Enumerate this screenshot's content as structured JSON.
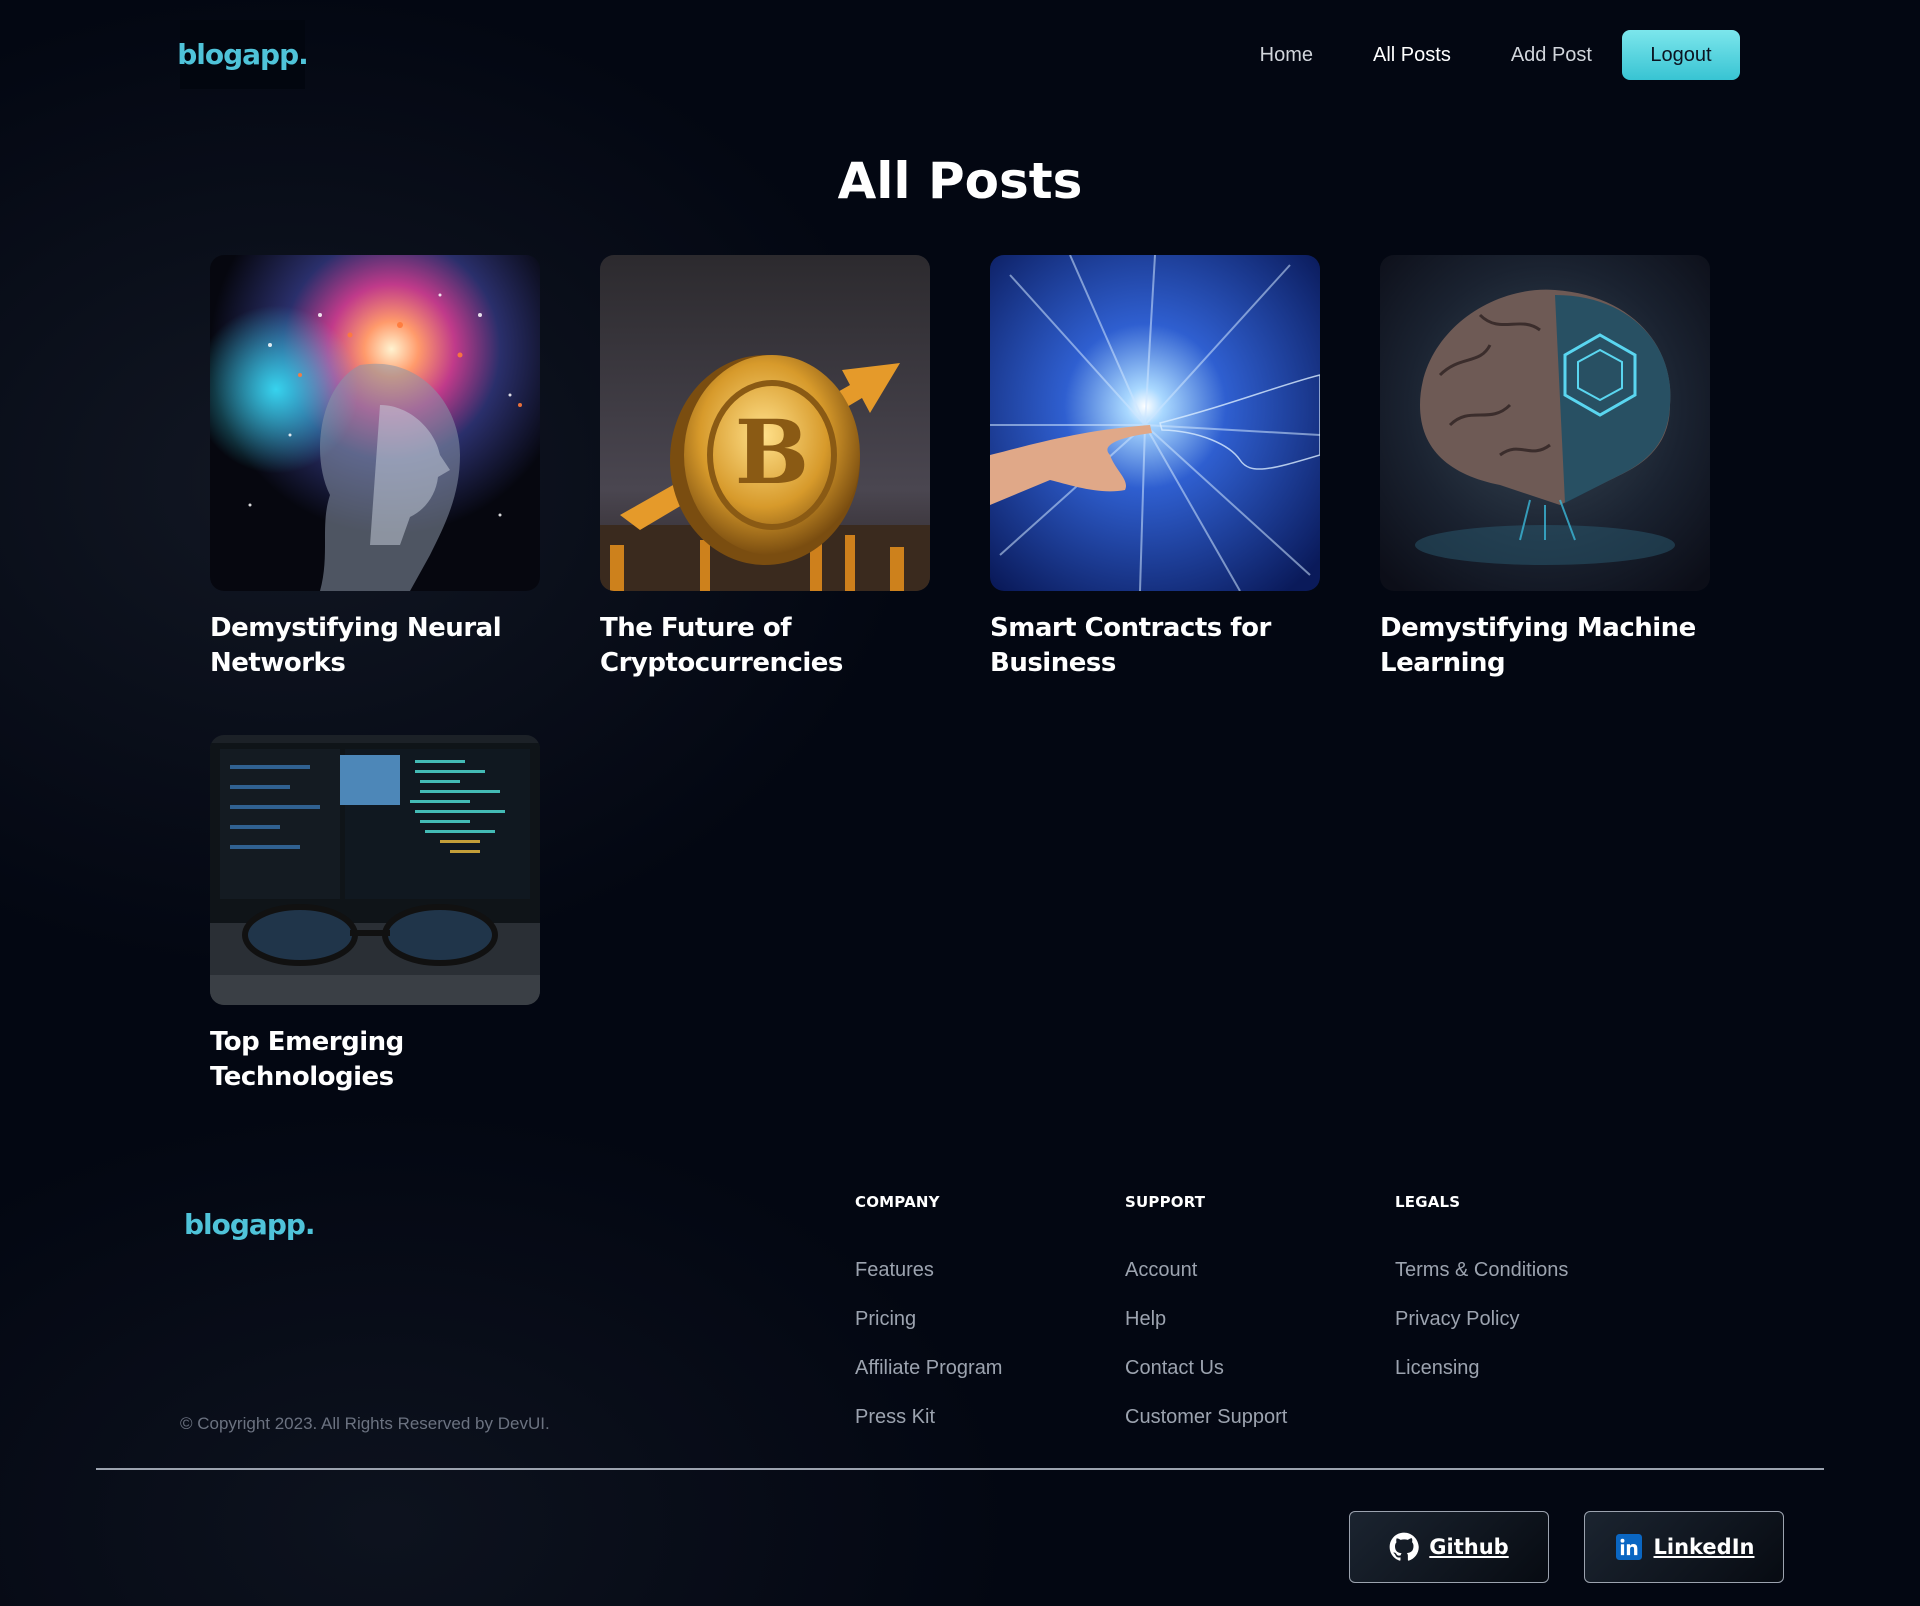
{
  "header": {
    "logo": "blogapp.",
    "nav": [
      {
        "label": "Home",
        "active": false
      },
      {
        "label": "All Posts",
        "active": true
      },
      {
        "label": "Add Post",
        "active": false
      }
    ],
    "logout_label": "Logout"
  },
  "page": {
    "title": "All Posts"
  },
  "posts": [
    {
      "title": "Demystifying Neural Networks",
      "image": "neural-head-explosion"
    },
    {
      "title": "The Future of Cryptocurrencies",
      "image": "bitcoin-coin-arrow"
    },
    {
      "title": "Smart Contracts for Business",
      "image": "human-digital-hand"
    },
    {
      "title": "Demystifying Machine Learning",
      "image": "circuit-brain"
    },
    {
      "title": "Top Emerging Technologies",
      "image": "code-monitor-glasses"
    }
  ],
  "footer": {
    "logo": "blogapp.",
    "copyright": "© Copyright 2023. All Rights Reserved by DevUI.",
    "columns": [
      {
        "heading": "COMPANY",
        "links": [
          "Features",
          "Pricing",
          "Affiliate Program",
          "Press Kit"
        ]
      },
      {
        "heading": "SUPPORT",
        "links": [
          "Account",
          "Help",
          "Contact Us",
          "Customer Support"
        ]
      },
      {
        "heading": "LEGALS",
        "links": [
          "Terms & Conditions",
          "Privacy Policy",
          "Licensing"
        ]
      }
    ],
    "social": {
      "github_label": "Github",
      "linkedin_label": "LinkedIn"
    }
  },
  "colors": {
    "accent": "#4fc3d9",
    "button": "#5fd6e0",
    "background": "#030712"
  }
}
